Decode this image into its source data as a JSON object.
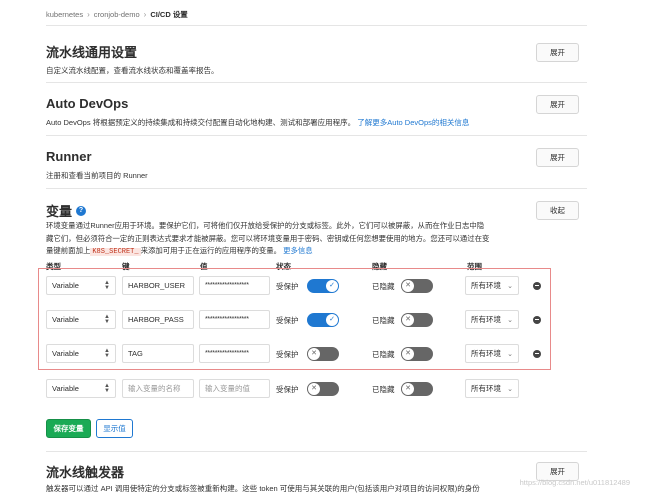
{
  "breadcrumb": {
    "items": [
      "kubernetes",
      "cronjob-demo",
      "CI/CD 设置"
    ]
  },
  "sections": {
    "pipelines": {
      "title": "流水线通用设置",
      "desc": "自定义流水线配置，查看流水线状态和覆盖率报告。",
      "button": "展开"
    },
    "autodevops": {
      "title": "Auto DevOps",
      "desc": "Auto DevOps 将根据预定义的持续集成和持续交付配置自动化地构建、测试和部署应用程序。",
      "link": "了解更多Auto DevOps的相关信息",
      "button": "展开"
    },
    "runner": {
      "title": "Runner",
      "desc": "注册和查看当前项目的 Runner",
      "button": "展开"
    },
    "variables": {
      "title": "变量",
      "button": "收起",
      "desc_line1": "环境变量通过Runner应用于环境。要保护它们，可将他们仅开放给受保护的分支或标签。此外，它们可以被屏蔽，从而在作业日志中隐",
      "desc_line2": "藏它们，但必须符合一定的正则表达式要求才能被屏蔽。您可以将环境变量用于密码、密钥或任何您想要使用的地方。您还可以通过在变",
      "desc_line3_pre": "量键前面加上",
      "desc_code": "K8S_SECRET_",
      "desc_line3_post": "来添加可用于正在运行的应用程序的变量。",
      "desc_link": "更多信息"
    },
    "triggers": {
      "title": "流水线触发器",
      "desc": "触发器可以通过 API 调用使特定的分支或标签被重新构建。这些 token 可使用与其关联的用户(包括该用户对项目的访问权限)的身份",
      "button": "展开"
    }
  },
  "table": {
    "headers": {
      "type": "类型",
      "key": "键",
      "value": "值",
      "state": "状态",
      "masked": "隐藏",
      "scope": "范围"
    },
    "rows": [
      {
        "type": "Variable",
        "key": "HARBOR_USER",
        "value": "******************",
        "protected_label": "受保护",
        "protected": true,
        "masked_label": "已隐藏",
        "masked": false,
        "scope": "所有环境"
      },
      {
        "type": "Variable",
        "key": "HARBOR_PASS",
        "value": "******************",
        "protected_label": "受保护",
        "protected": true,
        "masked_label": "已隐藏",
        "masked": false,
        "scope": "所有环境"
      },
      {
        "type": "Variable",
        "key": "TAG",
        "value": "******************",
        "protected_label": "受保护",
        "protected": false,
        "masked_label": "已隐藏",
        "masked": false,
        "scope": "所有环境"
      }
    ],
    "new_row": {
      "type": "Variable",
      "key_placeholder": "输入变量的名称",
      "value_placeholder": "输入变量的值",
      "protected_label": "受保护",
      "protected": false,
      "masked_label": "已隐藏",
      "masked": false,
      "scope": "所有环境"
    }
  },
  "actions": {
    "save": "保存变量",
    "reveal": "显示值"
  },
  "watermark": "https://blog.csdn.net/u011812489",
  "colors": {
    "primary": "#1f78d1",
    "success": "#1aaa55",
    "highlight_border": "#e88a8a"
  }
}
